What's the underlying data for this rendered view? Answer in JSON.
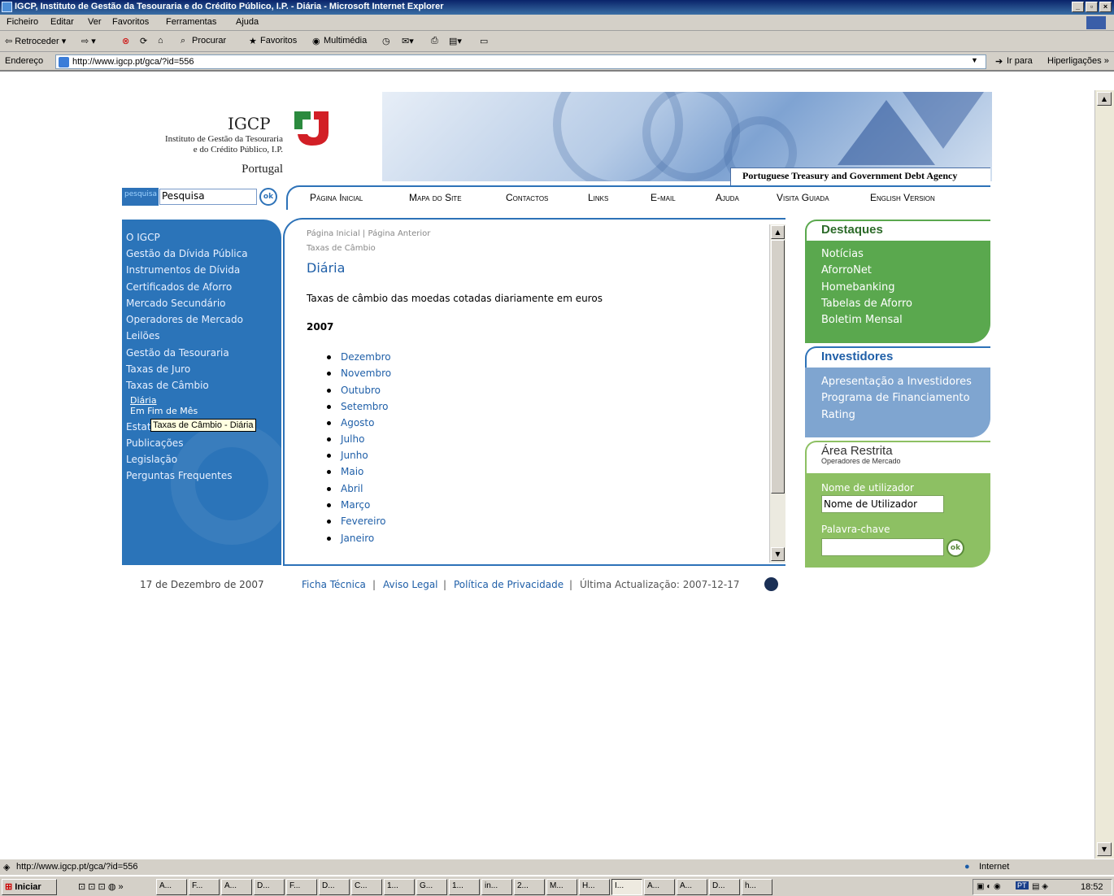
{
  "window": {
    "title": "IGCP, Instituto de Gestão da Tesouraria e do Crédito Público, I.P. - Diária - Microsoft Internet Explorer",
    "min": "_",
    "max": "▫",
    "close": "×"
  },
  "menu": [
    "Ficheiro",
    "Editar",
    "Ver",
    "Favoritos",
    "Ferramentas",
    "Ajuda"
  ],
  "toolbar": {
    "back": "⇦ Retroceder ▾",
    "forward": "⇨ ▾",
    "search": "Procurar",
    "favorites": "Favoritos",
    "multimedia": "Multimédia"
  },
  "address": {
    "label": "Endereço",
    "url": "http://www.igcp.pt/gca/?id=556",
    "go": "Ir para",
    "links": "Hiperligações »"
  },
  "header": {
    "logo": "IGCP",
    "line1": "Instituto de Gestão da Tesouraria",
    "line2": "e do Crédito Público, I.P.",
    "country": "Portugal",
    "agency": "Portuguese Treasury and Government Debt Agency"
  },
  "search": {
    "label": "pesquisa",
    "value": "Pesquisa",
    "ok": "ok"
  },
  "nav": [
    "Página Inicial",
    "Mapa do Site",
    "Contactos",
    "Links",
    "E-mail",
    "Ajuda",
    "Visita Guiada",
    "English Version"
  ],
  "leftnav": {
    "items": [
      "O IGCP",
      "Gestão da Dívida Pública",
      "Instrumentos de Dívida",
      "Certificados de Aforro",
      "Mercado Secundário",
      "Operadores de Mercado",
      "Leilões",
      "Gestão da Tesouraria",
      "Taxas de Juro",
      "Taxas de Câmbio"
    ],
    "sub": [
      "Diária",
      "Em Fim de Mês"
    ],
    "items2": [
      "Estat",
      "Publicações",
      "Legislação",
      "Perguntas Frequentes"
    ],
    "tooltip": "Taxas de Câmbio - Diária"
  },
  "content": {
    "breadcrumb_home": "Página Inicial",
    "breadcrumb_sep": "|",
    "breadcrumb_back": "Página Anterior",
    "section": "Taxas de Câmbio",
    "title": "Diária",
    "intro": "Taxas de câmbio das moedas cotadas diariamente em euros",
    "year": "2007",
    "months": [
      "Dezembro",
      "Novembro",
      "Outubro",
      "Setembro",
      "Agosto",
      "Julho",
      "Junho",
      "Maio",
      "Abril",
      "Março",
      "Fevereiro",
      "Janeiro"
    ]
  },
  "destaques": {
    "title": "Destaques",
    "color": "#5aa84e",
    "links": [
      "Notícias",
      "AforroNet",
      "Homebanking",
      "Tabelas de Aforro",
      "Boletim Mensal"
    ]
  },
  "investidores": {
    "title": "Investidores",
    "color": "#7fa5d0",
    "links": [
      "Apresentação a Investidores",
      "Programa de Financiamento",
      "Rating"
    ]
  },
  "restrita": {
    "title": "Área Restrita",
    "subtitle": "Operadores de Mercado",
    "color": "#8dc063",
    "user_label": "Nome de utilizador",
    "user_value": "Nome de Utilizador",
    "pass_label": "Palavra-chave",
    "ok": "ok"
  },
  "footer": {
    "date": "17 de Dezembro de 2007",
    "ficha": "Ficha Técnica",
    "aviso": "Aviso Legal",
    "politica": "Política de Privacidade",
    "sep": "|",
    "update": "Última Actualização: 2007-12-17"
  },
  "status": {
    "url": "http://www.igcp.pt/gca/?id=556",
    "zone": "Internet"
  },
  "taskbar": {
    "start": "Iniciar",
    "buttons": [
      "A...",
      "F...",
      "A...",
      "D...",
      "F...",
      "D...",
      "C...",
      "1...",
      "G...",
      "1...",
      "in...",
      "2...",
      "M...",
      "H...",
      "I...",
      "A...",
      "A...",
      "D...",
      "h..."
    ],
    "clock": "18:52",
    "lang": "PT"
  }
}
